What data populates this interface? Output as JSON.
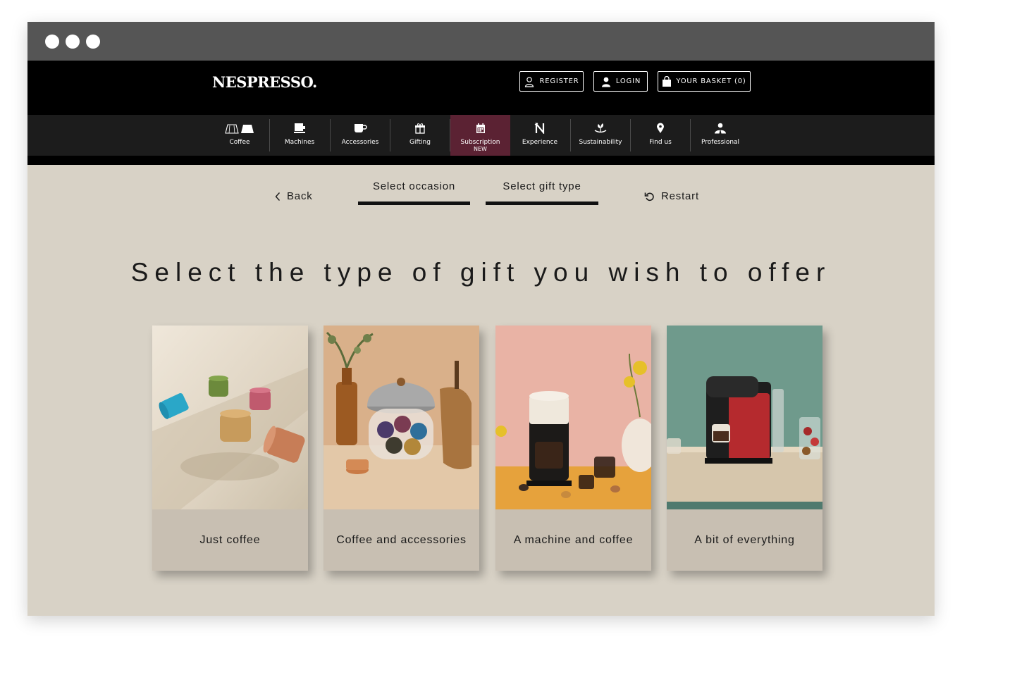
{
  "window": {
    "header": {
      "logo": "NESPRESSO.",
      "register_label": "REGISTER",
      "login_label": "LOGIN",
      "basket_label": "YOUR BASKET (0)"
    },
    "nav": [
      {
        "label": "Coffee",
        "icon": "coffee-capsule-icon"
      },
      {
        "label": "Machines",
        "icon": "machine-icon"
      },
      {
        "label": "Accessories",
        "icon": "cup-icon"
      },
      {
        "label": "Gifting",
        "icon": "gift-icon"
      },
      {
        "label": "Subscription",
        "sub": "NEW",
        "icon": "calendar-icon",
        "active": true
      },
      {
        "label": "Experience",
        "icon": "nespresso-n-icon"
      },
      {
        "label": "Sustainability",
        "icon": "leaf-icon"
      },
      {
        "label": "Find us",
        "icon": "location-pin-icon"
      },
      {
        "label": "Professional",
        "icon": "professional-icon"
      }
    ],
    "steps": {
      "back_label": "Back",
      "step1": "Select occasion",
      "step2": "Select gift type",
      "restart_label": "Restart"
    },
    "title": "Select the type of gift you wish to offer",
    "cards": [
      {
        "label": "Just coffee"
      },
      {
        "label": "Coffee and accessories"
      },
      {
        "label": "A machine and coffee"
      },
      {
        "label": "A bit of everything"
      }
    ],
    "colors": {
      "header_bg": "#000000",
      "nav_bg": "#1c1c1c",
      "active_nav": "#5b2233",
      "page_bg": "#d8d2c6",
      "card_label_bg": "#c8bfb2"
    }
  }
}
